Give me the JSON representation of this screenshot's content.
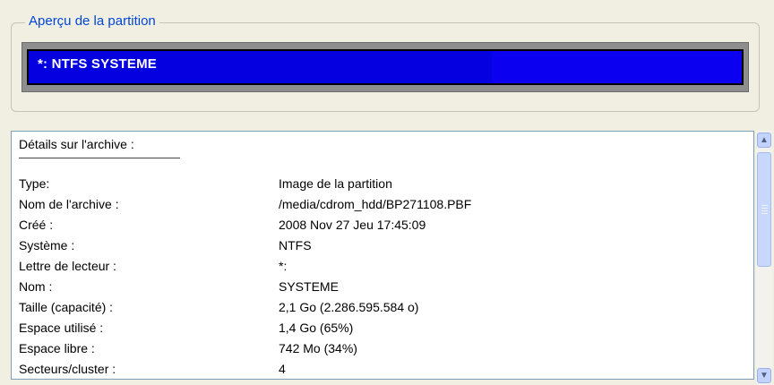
{
  "group": {
    "title": "Aperçu de la partition"
  },
  "partition": {
    "label": "*: NTFS SYSTEME",
    "used_fraction": 0.65
  },
  "details": {
    "heading": "Détails sur l'archive :",
    "rows": [
      {
        "label": "Type:",
        "value": "Image de la partition"
      },
      {
        "label": "Nom de l'archive :",
        "value": "/media/cdrom_hdd/BP271108.PBF"
      },
      {
        "label": "Créé :",
        "value": "2008 Nov 27  Jeu 17:45:09"
      },
      {
        "label": "Système :",
        "value": "NTFS"
      },
      {
        "label": "Lettre de lecteur :",
        "value": "*:"
      },
      {
        "label": "Nom :",
        "value": "SYSTEME"
      },
      {
        "label": "Taille (capacité) :",
        "value": "2,1 Go (2.286.595.584 o)"
      },
      {
        "label": "Espace utilisé :",
        "value": "1,4 Go (65%)"
      },
      {
        "label": "Espace libre :",
        "value": "742 Mo (34%)"
      },
      {
        "label": "Secteurs/cluster :",
        "value": "4"
      }
    ]
  },
  "scrollbar": {
    "up_icon": "chevron-up-icon",
    "down_icon": "chevron-down-icon"
  }
}
